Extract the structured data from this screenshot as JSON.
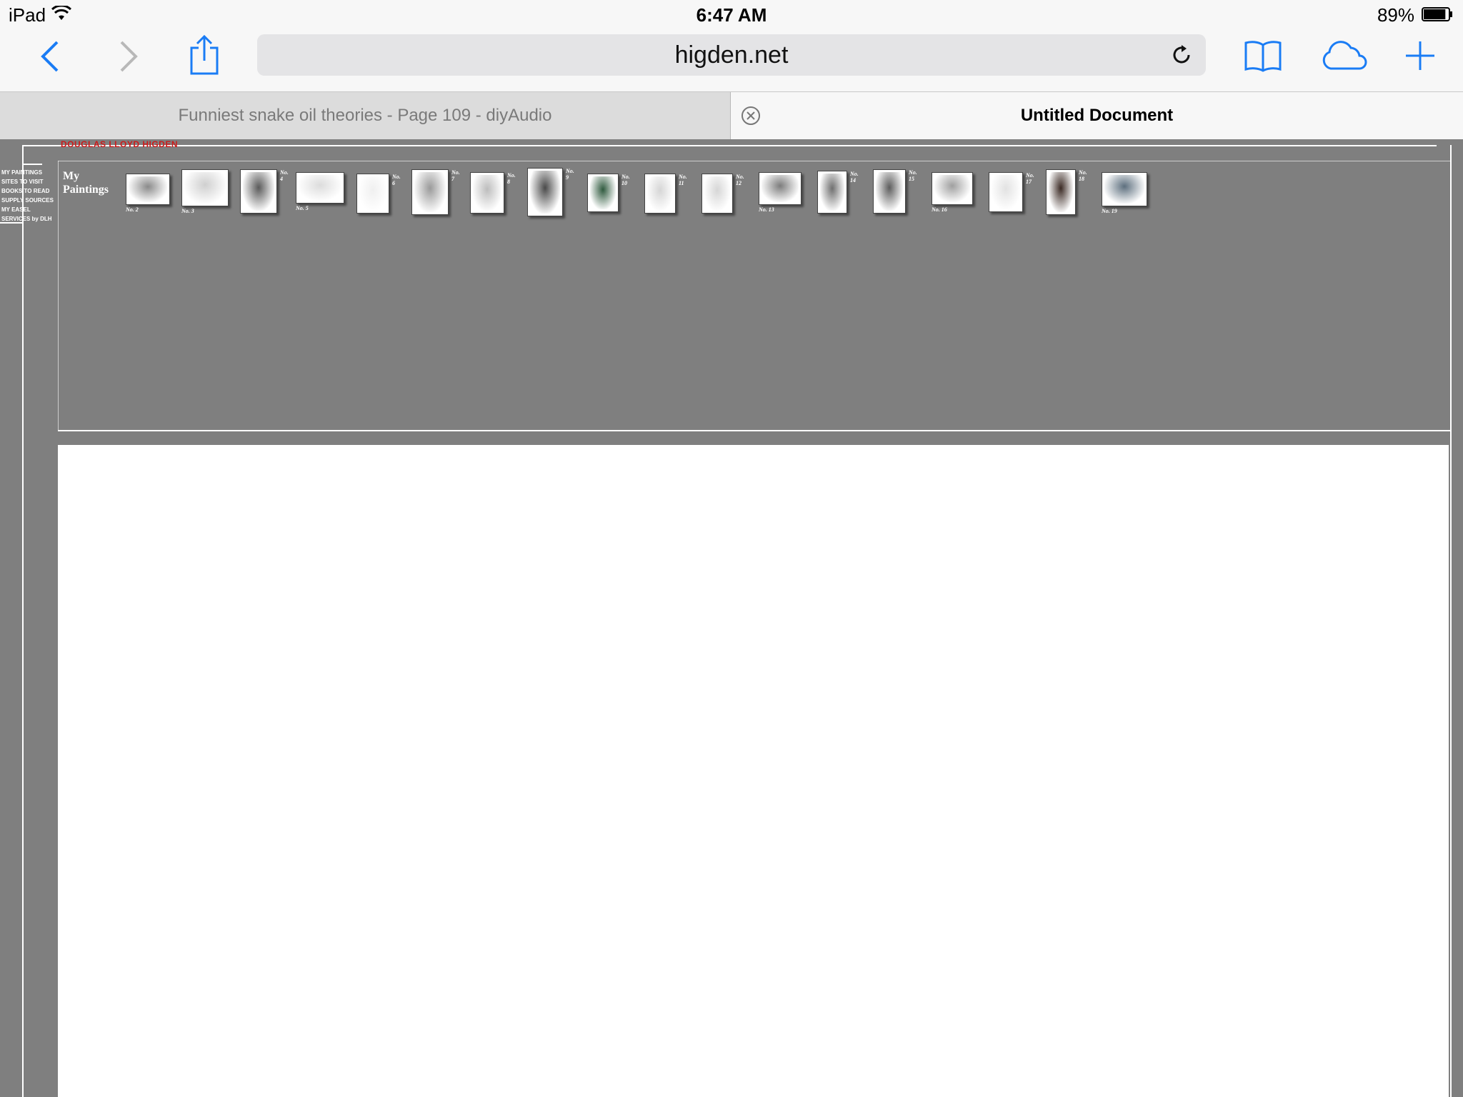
{
  "status_bar": {
    "device": "iPad",
    "time": "6:47 AM",
    "battery": "89%",
    "battery_level": 0.89
  },
  "toolbar": {
    "url": "higden.net"
  },
  "tabs": [
    {
      "title": "Funniest snake oil theories - Page 109 - diyAudio",
      "active": false
    },
    {
      "title": "Untitled Document",
      "active": true
    }
  ],
  "site": {
    "title": "DOUGLAS LLOYD HIGDEN",
    "nav": [
      "MY PAINTINGS",
      "SITES TO VISIT",
      "BOOKS TO READ",
      "SUPPLY SOURCES",
      "MY EASEL",
      "SERVICES by DLH"
    ],
    "gallery_heading": "My\nPaintings",
    "paintings": [
      {
        "label": "No. 2"
      },
      {
        "label": "No. 3"
      },
      {
        "label": "No. 4"
      },
      {
        "label": "No. 5"
      },
      {
        "label": "No. 6"
      },
      {
        "label": "No. 7"
      },
      {
        "label": "No. 8"
      },
      {
        "label": "No. 9"
      },
      {
        "label": "No. 10"
      },
      {
        "label": "No. 11"
      },
      {
        "label": "No. 12"
      },
      {
        "label": "No. 13"
      },
      {
        "label": "No. 14"
      },
      {
        "label": "No. 15"
      },
      {
        "label": "No. 16"
      },
      {
        "label": "No. 17"
      },
      {
        "label": "No. 18"
      },
      {
        "label": "No. 19"
      }
    ]
  },
  "colors": {
    "accent": "#1a7cf5",
    "page_background": "#7f7f7f",
    "title_red": "#cc1a1a"
  }
}
